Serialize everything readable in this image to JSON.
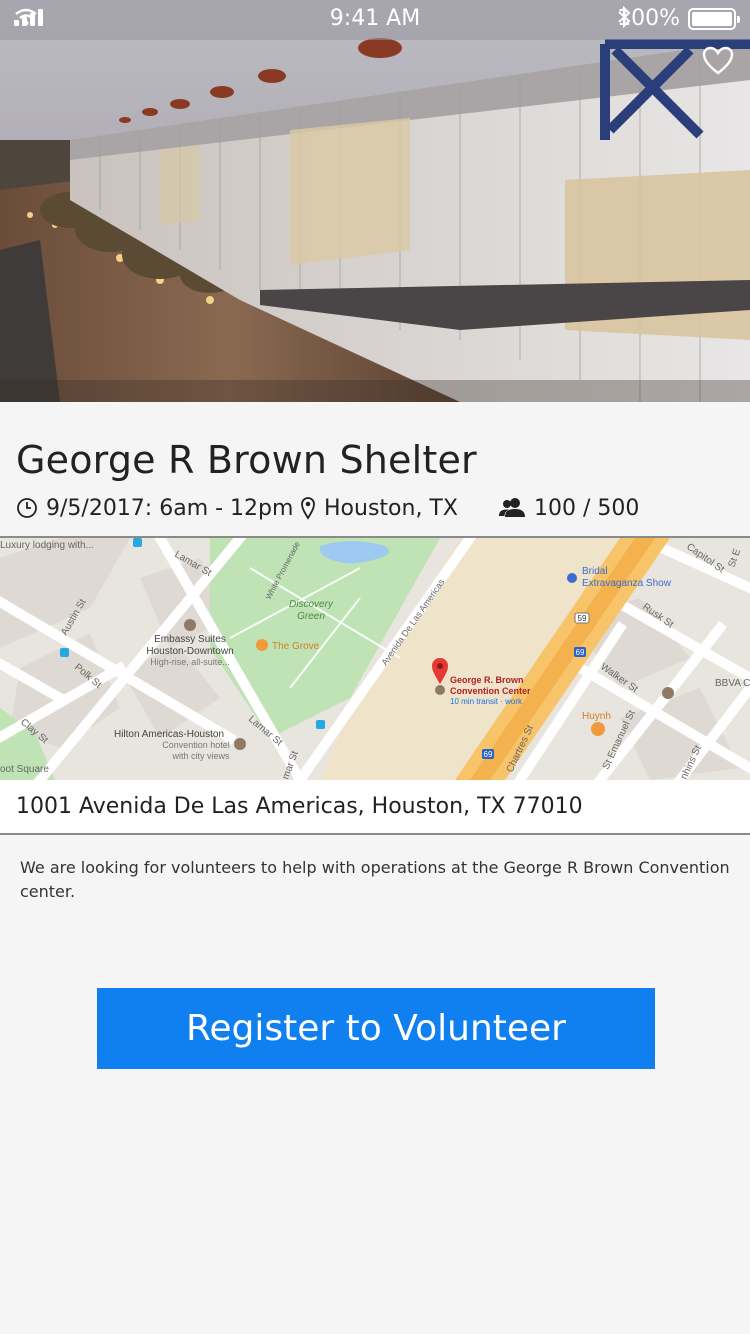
{
  "status_bar": {
    "time": "9:41 AM",
    "battery": "100%",
    "icons": [
      "signal-icon",
      "wifi-icon",
      "bluetooth-icon",
      "battery-icon"
    ]
  },
  "hero": {
    "image": "George R Brown Convention Center photo",
    "favorite_icon": "heart-icon"
  },
  "event": {
    "title": "George R Brown Shelter",
    "datetime": "9/5/2017: 6am - 12pm",
    "location": "Houston, TX",
    "capacity": "100 / 500",
    "address": "1001 Avenida De Las Americas, Houston, TX 77010",
    "description": "We are looking for volunteers to help with operations at the George R Brown Convention center."
  },
  "map": {
    "labels": {
      "luxury": "Luxury lodging with...",
      "lamar_top": "Lamar St",
      "austin": "Austin St",
      "polk": "Polk St",
      "clay": "Clay St",
      "embassy_1": "Embassy Suites",
      "embassy_2": "Houston-Downtown",
      "embassy_3": "High-rise, all-suite...",
      "grove": "The Grove",
      "discovery_1": "Discovery",
      "discovery_2": "Green",
      "white_promenade": "White Promenade",
      "lamar_mid": "Lamar St",
      "hilton_1": "Hilton Americas-Houston",
      "hilton_2": "Convention hotel",
      "hilton_3": "with city views",
      "avenida": "Avenida De Las Americas",
      "lamar_low": "mar St",
      "square": "oot Square",
      "grb_1": "George R. Brown",
      "grb_2": "Convention Center",
      "grb_3": "10 min transit · work",
      "bridal_1": "Bridal",
      "bridal_2": "Extravaganza Show",
      "capitol": "Capitol St",
      "rusk": "Rusk St",
      "walker": "Walker St",
      "bbva": "BBVA C",
      "huynh": "Huynh",
      "st_emanuel": "St Emanuel St",
      "chartres": "Chartres St",
      "jenkins": "nhins St",
      "st_e": "St E",
      "hwy59": "59",
      "hwy69a": "69",
      "hwy69b": "69"
    }
  },
  "actions": {
    "register_label": "Register to Volunteer"
  }
}
